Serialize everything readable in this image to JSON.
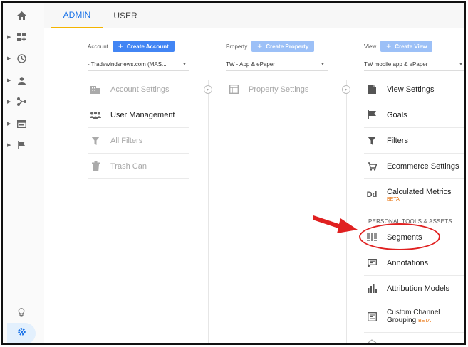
{
  "tabs": {
    "admin": "ADMIN",
    "user": "USER"
  },
  "account": {
    "label": "Account",
    "create_label": "Create Account",
    "selected": "- Tradewindsnews.com (MAS...",
    "items": [
      {
        "label": "Account Settings",
        "icon": "building-icon"
      },
      {
        "label": "User Management",
        "icon": "users-icon"
      },
      {
        "label": "All Filters",
        "icon": "filter-icon"
      },
      {
        "label": "Trash Can",
        "icon": "trash-icon"
      }
    ]
  },
  "property": {
    "label": "Property",
    "create_label": "Create Property",
    "selected": "TW - App & ePaper",
    "items": [
      {
        "label": "Property Settings",
        "icon": "property-settings-icon"
      }
    ]
  },
  "view": {
    "label": "View",
    "create_label": "Create View",
    "selected": "TW mobile app & ePaper",
    "items": [
      {
        "label": "View Settings",
        "icon": "document-icon"
      },
      {
        "label": "Goals",
        "icon": "flag-icon"
      },
      {
        "label": "Filters",
        "icon": "filter-icon"
      },
      {
        "label": "Ecommerce Settings",
        "icon": "cart-icon"
      },
      {
        "label": "Calculated Metrics",
        "badge": "BETA",
        "icon": "dd-icon"
      }
    ],
    "section_title": "PERSONAL TOOLS & ASSETS",
    "personal_items": [
      {
        "label": "Segments",
        "icon": "segments-icon"
      },
      {
        "label": "Annotations",
        "icon": "annotation-icon"
      },
      {
        "label": "Attribution Models",
        "icon": "bar-chart-icon"
      },
      {
        "label": "Custom Channel",
        "label2": "Grouping",
        "badge": "BETA",
        "icon": "channel-icon"
      }
    ]
  },
  "colors": {
    "accent": "#4285f4",
    "highlight": "#e02020",
    "tab_underline": "#f4b400"
  }
}
